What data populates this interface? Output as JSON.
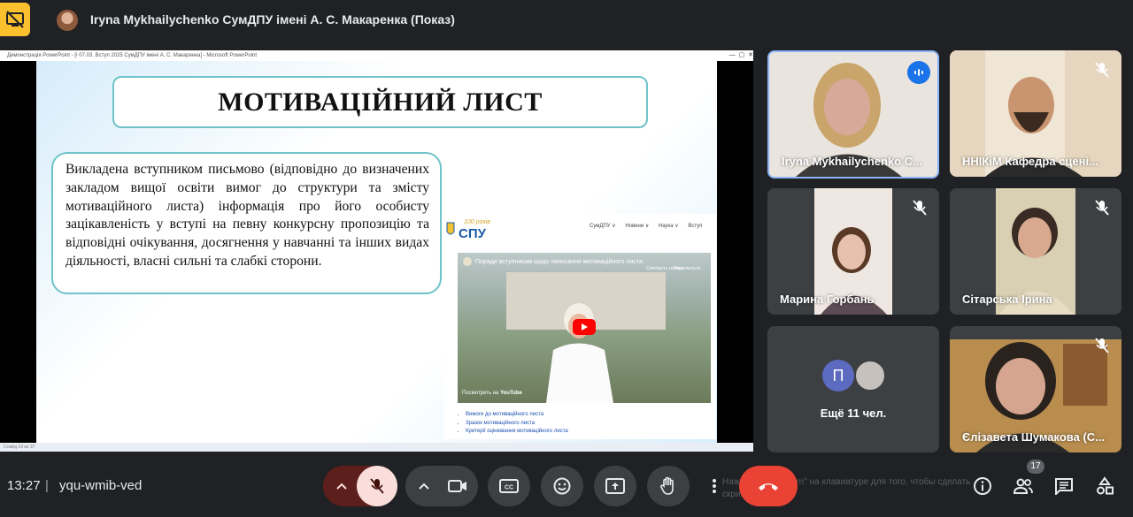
{
  "header": {
    "presenter_title": "Iryna Mykhailychenko СумДПУ імені А. С. Макаренка (Показ)"
  },
  "presentation": {
    "window_title": "Демонстрація PowerPoint - [I 07.03. Вступ 2025 СумДПУ імені А. С. Макаренка] - Microsoft PowerPoint",
    "status_bar": "Слайд 19 из 37",
    "slide_title": "МОТИВАЦІЙНИЙ ЛИСТ",
    "slide_text": "Викладена вступником письмово (відповідно до визначених закладом вищої освіти вимог до структури та змісту мотиваційного листа) інформація про його особисту зацікавленість у вступі на певну конкурсну пропозицію та відповідні очікування, досягнення у навчанні та інших видах діяльності, власні сильні та слабкі сторони.",
    "web": {
      "logo_top": "100 років",
      "logo_text": "СПУ",
      "nav": [
        "СумДПУ ∨",
        "Новини ∨",
        "Наука ∨",
        "Вступ"
      ],
      "video_title": "Поради вступникам щодо написання мотиваційного листа",
      "video_later": "Смотреть позже",
      "video_share": "Поделиться",
      "video_watch_on": "Посмотреть на",
      "video_platform": "YouTube",
      "links": [
        "Вимоги до мотиваційного листа",
        "Зразок мотиваційного листа",
        "Критерії оцінювання мотиваційного листа"
      ]
    }
  },
  "participants": [
    {
      "name": "Iryna Mykhailychenko С...",
      "speaking": true
    },
    {
      "name": "ННІКіМ Кафедра сцені...",
      "muted": true
    },
    {
      "name": "Марина Горбань",
      "muted": true
    },
    {
      "name": "Сітарська Ірина",
      "muted": true
    },
    {
      "name": "Ещё 11 чел.",
      "avatar_letter": "П"
    },
    {
      "name": "Єлізавета Шумакова (С...",
      "muted": true
    }
  ],
  "bottom_bar": {
    "time": "13:27",
    "separator": "|",
    "meeting_code": "yqu-wmib-ved",
    "people_count": "17",
    "overlay_hint": "Нажмите \"Print Scrn\" на клавиатуре для того, чтобы сделать скриншот"
  },
  "colors": {
    "background": "#202124",
    "end_call": "#ea4335",
    "mic_off_bg": "#f9dedc",
    "present_badge": "#fbc02d",
    "speaking_border": "#8ab4f8",
    "slide_box_border": "#6fc3c9"
  }
}
